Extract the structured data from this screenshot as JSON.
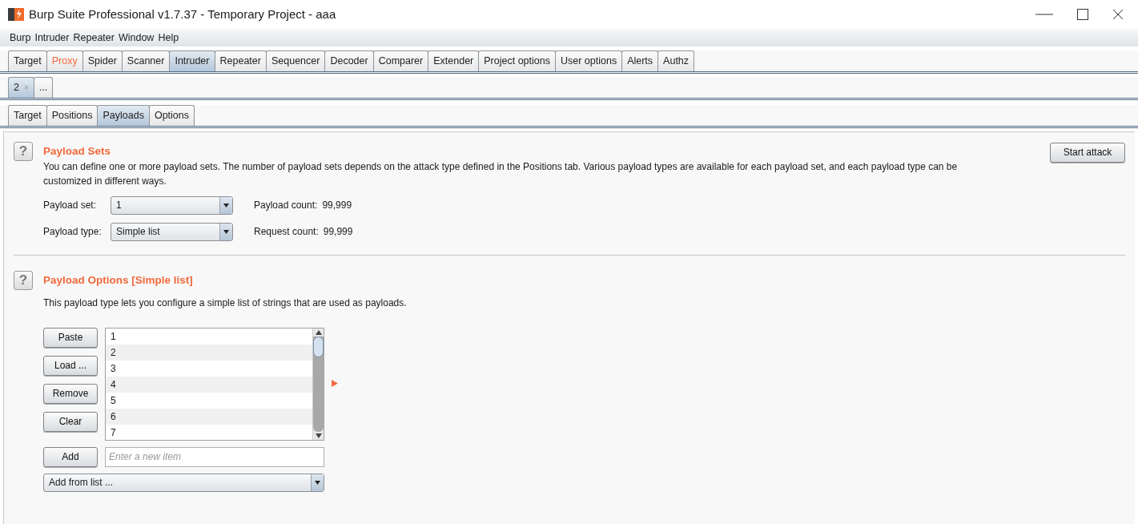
{
  "window": {
    "title": "Burp Suite Professional v1.7.37 - Temporary Project - aaa"
  },
  "menu": [
    "Burp",
    "Intruder",
    "Repeater",
    "Window",
    "Help"
  ],
  "main_tabs": [
    {
      "label": "Target",
      "selected": false,
      "highlighted": false
    },
    {
      "label": "Proxy",
      "selected": false,
      "highlighted": true
    },
    {
      "label": "Spider",
      "selected": false,
      "highlighted": false
    },
    {
      "label": "Scanner",
      "selected": false,
      "highlighted": false
    },
    {
      "label": "Intruder",
      "selected": true,
      "highlighted": false
    },
    {
      "label": "Repeater",
      "selected": false,
      "highlighted": false
    },
    {
      "label": "Sequencer",
      "selected": false,
      "highlighted": false
    },
    {
      "label": "Decoder",
      "selected": false,
      "highlighted": false
    },
    {
      "label": "Comparer",
      "selected": false,
      "highlighted": false
    },
    {
      "label": "Extender",
      "selected": false,
      "highlighted": false
    },
    {
      "label": "Project options",
      "selected": false,
      "highlighted": false
    },
    {
      "label": "User options",
      "selected": false,
      "highlighted": false
    },
    {
      "label": "Alerts",
      "selected": false,
      "highlighted": false
    },
    {
      "label": "Authz",
      "selected": false,
      "highlighted": false
    }
  ],
  "attack_tabs": [
    {
      "label": "2",
      "close": "×",
      "selected": true
    },
    {
      "label": "...",
      "selected": false
    }
  ],
  "sub_tabs": [
    {
      "label": "Target",
      "selected": false
    },
    {
      "label": "Positions",
      "selected": false
    },
    {
      "label": "Payloads",
      "selected": true
    },
    {
      "label": "Options",
      "selected": false
    }
  ],
  "payload_sets": {
    "help": "?",
    "title": "Payload Sets",
    "start_button": "Start attack",
    "description": "You can define one or more payload sets. The number of payload sets depends on the attack type defined in the Positions tab. Various payload types are available for each payload set, and each payload type can be customized in different ways.",
    "fields": [
      {
        "label": "Payload set:",
        "value": "1",
        "count_label": "Payload count:",
        "count": "99,999"
      },
      {
        "label": "Payload type:",
        "value": "Simple list",
        "count_label": "Request count:",
        "count": "99,999"
      }
    ]
  },
  "payload_options": {
    "help": "?",
    "title": "Payload Options [Simple list]",
    "description": "This payload type lets you configure a simple list of strings that are used as payloads.",
    "buttons": [
      "Paste",
      "Load ...",
      "Remove",
      "Clear"
    ],
    "items": [
      "1",
      "2",
      "3",
      "4",
      "5",
      "6",
      "7"
    ],
    "add_button": "Add",
    "new_item": {
      "placeholder": "Enter a new item"
    },
    "add_from_list": "Add from list ..."
  }
}
